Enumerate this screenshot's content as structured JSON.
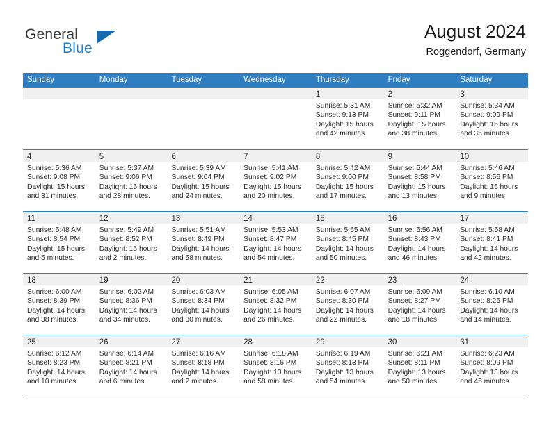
{
  "brand": {
    "name_part1": "General",
    "name_part2": "Blue",
    "triangle_color": "#1769ad",
    "blue_color": "#1b7fd4"
  },
  "header": {
    "title": "August 2024",
    "location": "Roggendorf, Germany"
  },
  "theme": {
    "header_bar_color": "#2f7ec1",
    "daynum_bg": "#f0f0f0",
    "text_color": "#2b2b2b"
  },
  "weekdays": [
    "Sunday",
    "Monday",
    "Tuesday",
    "Wednesday",
    "Thursday",
    "Friday",
    "Saturday"
  ],
  "weeks": [
    [
      {
        "day": "",
        "lines": []
      },
      {
        "day": "",
        "lines": []
      },
      {
        "day": "",
        "lines": []
      },
      {
        "day": "",
        "lines": []
      },
      {
        "day": "1",
        "lines": [
          "Sunrise: 5:31 AM",
          "Sunset: 9:13 PM",
          "Daylight: 15 hours",
          "and 42 minutes."
        ]
      },
      {
        "day": "2",
        "lines": [
          "Sunrise: 5:32 AM",
          "Sunset: 9:11 PM",
          "Daylight: 15 hours",
          "and 38 minutes."
        ]
      },
      {
        "day": "3",
        "lines": [
          "Sunrise: 5:34 AM",
          "Sunset: 9:09 PM",
          "Daylight: 15 hours",
          "and 35 minutes."
        ]
      }
    ],
    [
      {
        "day": "4",
        "lines": [
          "Sunrise: 5:36 AM",
          "Sunset: 9:08 PM",
          "Daylight: 15 hours",
          "and 31 minutes."
        ]
      },
      {
        "day": "5",
        "lines": [
          "Sunrise: 5:37 AM",
          "Sunset: 9:06 PM",
          "Daylight: 15 hours",
          "and 28 minutes."
        ]
      },
      {
        "day": "6",
        "lines": [
          "Sunrise: 5:39 AM",
          "Sunset: 9:04 PM",
          "Daylight: 15 hours",
          "and 24 minutes."
        ]
      },
      {
        "day": "7",
        "lines": [
          "Sunrise: 5:41 AM",
          "Sunset: 9:02 PM",
          "Daylight: 15 hours",
          "and 20 minutes."
        ]
      },
      {
        "day": "8",
        "lines": [
          "Sunrise: 5:42 AM",
          "Sunset: 9:00 PM",
          "Daylight: 15 hours",
          "and 17 minutes."
        ]
      },
      {
        "day": "9",
        "lines": [
          "Sunrise: 5:44 AM",
          "Sunset: 8:58 PM",
          "Daylight: 15 hours",
          "and 13 minutes."
        ]
      },
      {
        "day": "10",
        "lines": [
          "Sunrise: 5:46 AM",
          "Sunset: 8:56 PM",
          "Daylight: 15 hours",
          "and 9 minutes."
        ]
      }
    ],
    [
      {
        "day": "11",
        "lines": [
          "Sunrise: 5:48 AM",
          "Sunset: 8:54 PM",
          "Daylight: 15 hours",
          "and 5 minutes."
        ]
      },
      {
        "day": "12",
        "lines": [
          "Sunrise: 5:49 AM",
          "Sunset: 8:52 PM",
          "Daylight: 15 hours",
          "and 2 minutes."
        ]
      },
      {
        "day": "13",
        "lines": [
          "Sunrise: 5:51 AM",
          "Sunset: 8:49 PM",
          "Daylight: 14 hours",
          "and 58 minutes."
        ]
      },
      {
        "day": "14",
        "lines": [
          "Sunrise: 5:53 AM",
          "Sunset: 8:47 PM",
          "Daylight: 14 hours",
          "and 54 minutes."
        ]
      },
      {
        "day": "15",
        "lines": [
          "Sunrise: 5:55 AM",
          "Sunset: 8:45 PM",
          "Daylight: 14 hours",
          "and 50 minutes."
        ]
      },
      {
        "day": "16",
        "lines": [
          "Sunrise: 5:56 AM",
          "Sunset: 8:43 PM",
          "Daylight: 14 hours",
          "and 46 minutes."
        ]
      },
      {
        "day": "17",
        "lines": [
          "Sunrise: 5:58 AM",
          "Sunset: 8:41 PM",
          "Daylight: 14 hours",
          "and 42 minutes."
        ]
      }
    ],
    [
      {
        "day": "18",
        "lines": [
          "Sunrise: 6:00 AM",
          "Sunset: 8:39 PM",
          "Daylight: 14 hours",
          "and 38 minutes."
        ]
      },
      {
        "day": "19",
        "lines": [
          "Sunrise: 6:02 AM",
          "Sunset: 8:36 PM",
          "Daylight: 14 hours",
          "and 34 minutes."
        ]
      },
      {
        "day": "20",
        "lines": [
          "Sunrise: 6:03 AM",
          "Sunset: 8:34 PM",
          "Daylight: 14 hours",
          "and 30 minutes."
        ]
      },
      {
        "day": "21",
        "lines": [
          "Sunrise: 6:05 AM",
          "Sunset: 8:32 PM",
          "Daylight: 14 hours",
          "and 26 minutes."
        ]
      },
      {
        "day": "22",
        "lines": [
          "Sunrise: 6:07 AM",
          "Sunset: 8:30 PM",
          "Daylight: 14 hours",
          "and 22 minutes."
        ]
      },
      {
        "day": "23",
        "lines": [
          "Sunrise: 6:09 AM",
          "Sunset: 8:27 PM",
          "Daylight: 14 hours",
          "and 18 minutes."
        ]
      },
      {
        "day": "24",
        "lines": [
          "Sunrise: 6:10 AM",
          "Sunset: 8:25 PM",
          "Daylight: 14 hours",
          "and 14 minutes."
        ]
      }
    ],
    [
      {
        "day": "25",
        "lines": [
          "Sunrise: 6:12 AM",
          "Sunset: 8:23 PM",
          "Daylight: 14 hours",
          "and 10 minutes."
        ]
      },
      {
        "day": "26",
        "lines": [
          "Sunrise: 6:14 AM",
          "Sunset: 8:21 PM",
          "Daylight: 14 hours",
          "and 6 minutes."
        ]
      },
      {
        "day": "27",
        "lines": [
          "Sunrise: 6:16 AM",
          "Sunset: 8:18 PM",
          "Daylight: 14 hours",
          "and 2 minutes."
        ]
      },
      {
        "day": "28",
        "lines": [
          "Sunrise: 6:18 AM",
          "Sunset: 8:16 PM",
          "Daylight: 13 hours",
          "and 58 minutes."
        ]
      },
      {
        "day": "29",
        "lines": [
          "Sunrise: 6:19 AM",
          "Sunset: 8:13 PM",
          "Daylight: 13 hours",
          "and 54 minutes."
        ]
      },
      {
        "day": "30",
        "lines": [
          "Sunrise: 6:21 AM",
          "Sunset: 8:11 PM",
          "Daylight: 13 hours",
          "and 50 minutes."
        ]
      },
      {
        "day": "31",
        "lines": [
          "Sunrise: 6:23 AM",
          "Sunset: 8:09 PM",
          "Daylight: 13 hours",
          "and 45 minutes."
        ]
      }
    ]
  ]
}
